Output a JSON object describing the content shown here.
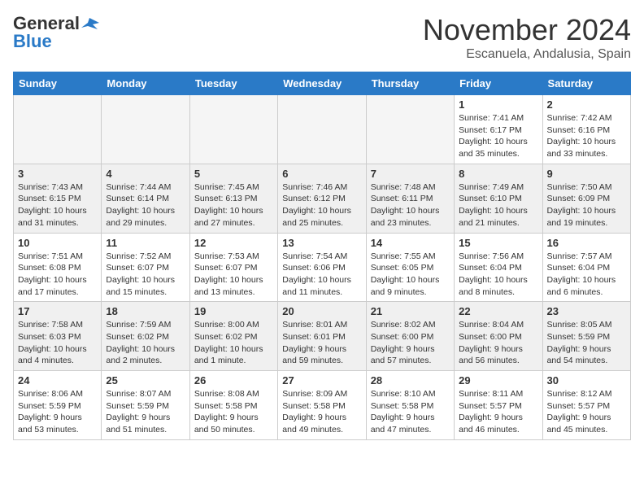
{
  "header": {
    "logo_line1": "General",
    "logo_line2": "Blue",
    "month": "November 2024",
    "location": "Escanuela, Andalusia, Spain"
  },
  "weekdays": [
    "Sunday",
    "Monday",
    "Tuesday",
    "Wednesday",
    "Thursday",
    "Friday",
    "Saturday"
  ],
  "weeks": [
    [
      {
        "day": "",
        "info": ""
      },
      {
        "day": "",
        "info": ""
      },
      {
        "day": "",
        "info": ""
      },
      {
        "day": "",
        "info": ""
      },
      {
        "day": "",
        "info": ""
      },
      {
        "day": "1",
        "info": "Sunrise: 7:41 AM\nSunset: 6:17 PM\nDaylight: 10 hours\nand 35 minutes."
      },
      {
        "day": "2",
        "info": "Sunrise: 7:42 AM\nSunset: 6:16 PM\nDaylight: 10 hours\nand 33 minutes."
      }
    ],
    [
      {
        "day": "3",
        "info": "Sunrise: 7:43 AM\nSunset: 6:15 PM\nDaylight: 10 hours\nand 31 minutes."
      },
      {
        "day": "4",
        "info": "Sunrise: 7:44 AM\nSunset: 6:14 PM\nDaylight: 10 hours\nand 29 minutes."
      },
      {
        "day": "5",
        "info": "Sunrise: 7:45 AM\nSunset: 6:13 PM\nDaylight: 10 hours\nand 27 minutes."
      },
      {
        "day": "6",
        "info": "Sunrise: 7:46 AM\nSunset: 6:12 PM\nDaylight: 10 hours\nand 25 minutes."
      },
      {
        "day": "7",
        "info": "Sunrise: 7:48 AM\nSunset: 6:11 PM\nDaylight: 10 hours\nand 23 minutes."
      },
      {
        "day": "8",
        "info": "Sunrise: 7:49 AM\nSunset: 6:10 PM\nDaylight: 10 hours\nand 21 minutes."
      },
      {
        "day": "9",
        "info": "Sunrise: 7:50 AM\nSunset: 6:09 PM\nDaylight: 10 hours\nand 19 minutes."
      }
    ],
    [
      {
        "day": "10",
        "info": "Sunrise: 7:51 AM\nSunset: 6:08 PM\nDaylight: 10 hours\nand 17 minutes."
      },
      {
        "day": "11",
        "info": "Sunrise: 7:52 AM\nSunset: 6:07 PM\nDaylight: 10 hours\nand 15 minutes."
      },
      {
        "day": "12",
        "info": "Sunrise: 7:53 AM\nSunset: 6:07 PM\nDaylight: 10 hours\nand 13 minutes."
      },
      {
        "day": "13",
        "info": "Sunrise: 7:54 AM\nSunset: 6:06 PM\nDaylight: 10 hours\nand 11 minutes."
      },
      {
        "day": "14",
        "info": "Sunrise: 7:55 AM\nSunset: 6:05 PM\nDaylight: 10 hours\nand 9 minutes."
      },
      {
        "day": "15",
        "info": "Sunrise: 7:56 AM\nSunset: 6:04 PM\nDaylight: 10 hours\nand 8 minutes."
      },
      {
        "day": "16",
        "info": "Sunrise: 7:57 AM\nSunset: 6:04 PM\nDaylight: 10 hours\nand 6 minutes."
      }
    ],
    [
      {
        "day": "17",
        "info": "Sunrise: 7:58 AM\nSunset: 6:03 PM\nDaylight: 10 hours\nand 4 minutes."
      },
      {
        "day": "18",
        "info": "Sunrise: 7:59 AM\nSunset: 6:02 PM\nDaylight: 10 hours\nand 2 minutes."
      },
      {
        "day": "19",
        "info": "Sunrise: 8:00 AM\nSunset: 6:02 PM\nDaylight: 10 hours\nand 1 minute."
      },
      {
        "day": "20",
        "info": "Sunrise: 8:01 AM\nSunset: 6:01 PM\nDaylight: 9 hours\nand 59 minutes."
      },
      {
        "day": "21",
        "info": "Sunrise: 8:02 AM\nSunset: 6:00 PM\nDaylight: 9 hours\nand 57 minutes."
      },
      {
        "day": "22",
        "info": "Sunrise: 8:04 AM\nSunset: 6:00 PM\nDaylight: 9 hours\nand 56 minutes."
      },
      {
        "day": "23",
        "info": "Sunrise: 8:05 AM\nSunset: 5:59 PM\nDaylight: 9 hours\nand 54 minutes."
      }
    ],
    [
      {
        "day": "24",
        "info": "Sunrise: 8:06 AM\nSunset: 5:59 PM\nDaylight: 9 hours\nand 53 minutes."
      },
      {
        "day": "25",
        "info": "Sunrise: 8:07 AM\nSunset: 5:59 PM\nDaylight: 9 hours\nand 51 minutes."
      },
      {
        "day": "26",
        "info": "Sunrise: 8:08 AM\nSunset: 5:58 PM\nDaylight: 9 hours\nand 50 minutes."
      },
      {
        "day": "27",
        "info": "Sunrise: 8:09 AM\nSunset: 5:58 PM\nDaylight: 9 hours\nand 49 minutes."
      },
      {
        "day": "28",
        "info": "Sunrise: 8:10 AM\nSunset: 5:58 PM\nDaylight: 9 hours\nand 47 minutes."
      },
      {
        "day": "29",
        "info": "Sunrise: 8:11 AM\nSunset: 5:57 PM\nDaylight: 9 hours\nand 46 minutes."
      },
      {
        "day": "30",
        "info": "Sunrise: 8:12 AM\nSunset: 5:57 PM\nDaylight: 9 hours\nand 45 minutes."
      }
    ]
  ]
}
